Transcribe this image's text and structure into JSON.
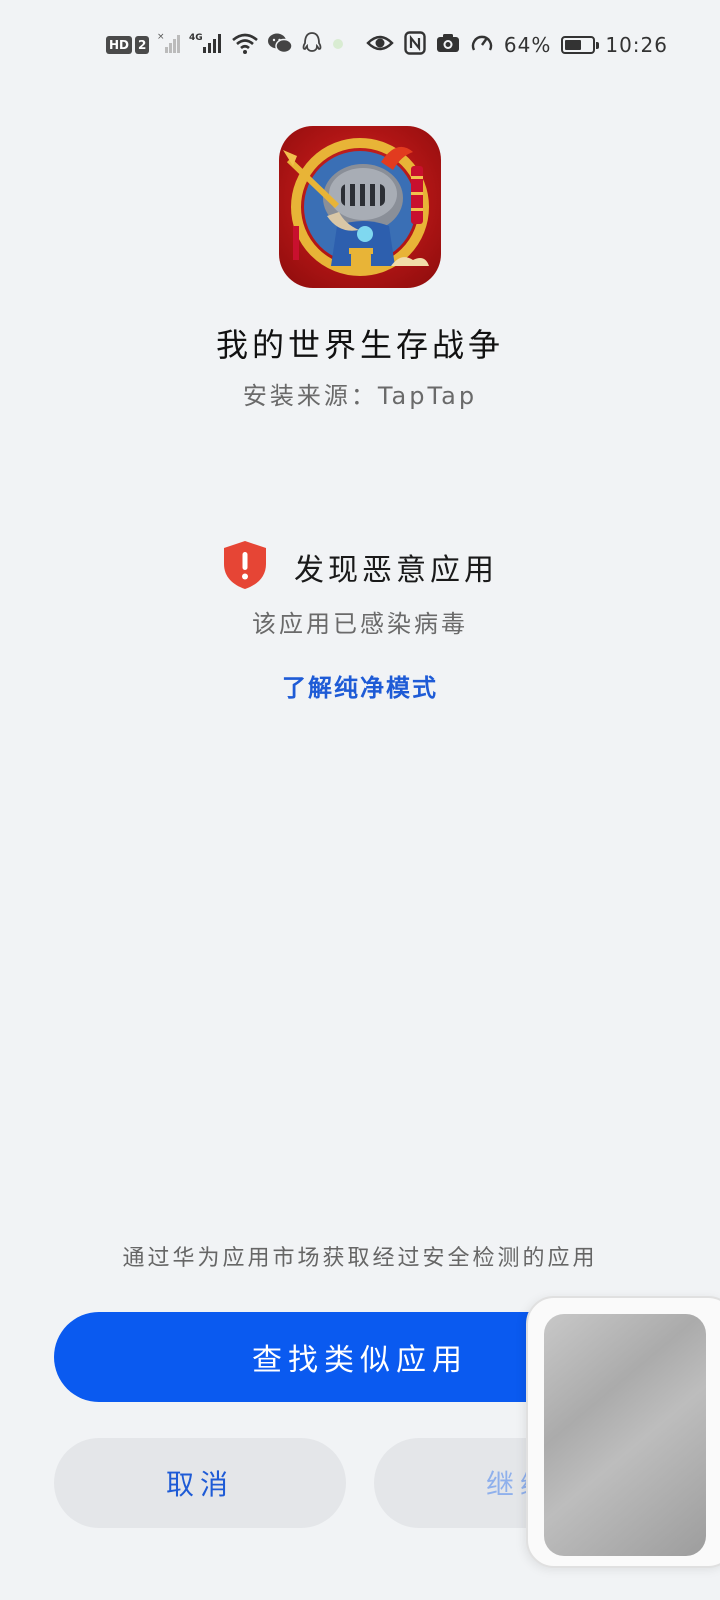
{
  "status_bar": {
    "hd_label": "HD",
    "sim_label": "2",
    "network_label": "4G",
    "battery_text": "64%",
    "battery_level": 0.64,
    "time": "10:26",
    "icons": [
      "signal-x-icon",
      "signal-icon",
      "wifi-icon",
      "wechat-icon",
      "qq-icon",
      "eye-icon",
      "nfc-icon",
      "camera-icon",
      "speed-icon",
      "battery-icon"
    ]
  },
  "app": {
    "name": "我的世界生存战争",
    "source": "安装来源：TapTap",
    "icon": "knight-game-icon"
  },
  "warning": {
    "title": "发现恶意应用",
    "subtitle": "该应用已感染病毒",
    "learn_more": "了解纯净模式",
    "icon": "shield-alert-icon",
    "color": "#e64535"
  },
  "bottom": {
    "hint": "通过华为应用市场获取经过安全检测的应用",
    "primary_button": "查找类似应用",
    "cancel_button": "取消",
    "continue_button": "继续",
    "primary_color": "#0a5af0",
    "link_color": "#1e5bd6"
  }
}
